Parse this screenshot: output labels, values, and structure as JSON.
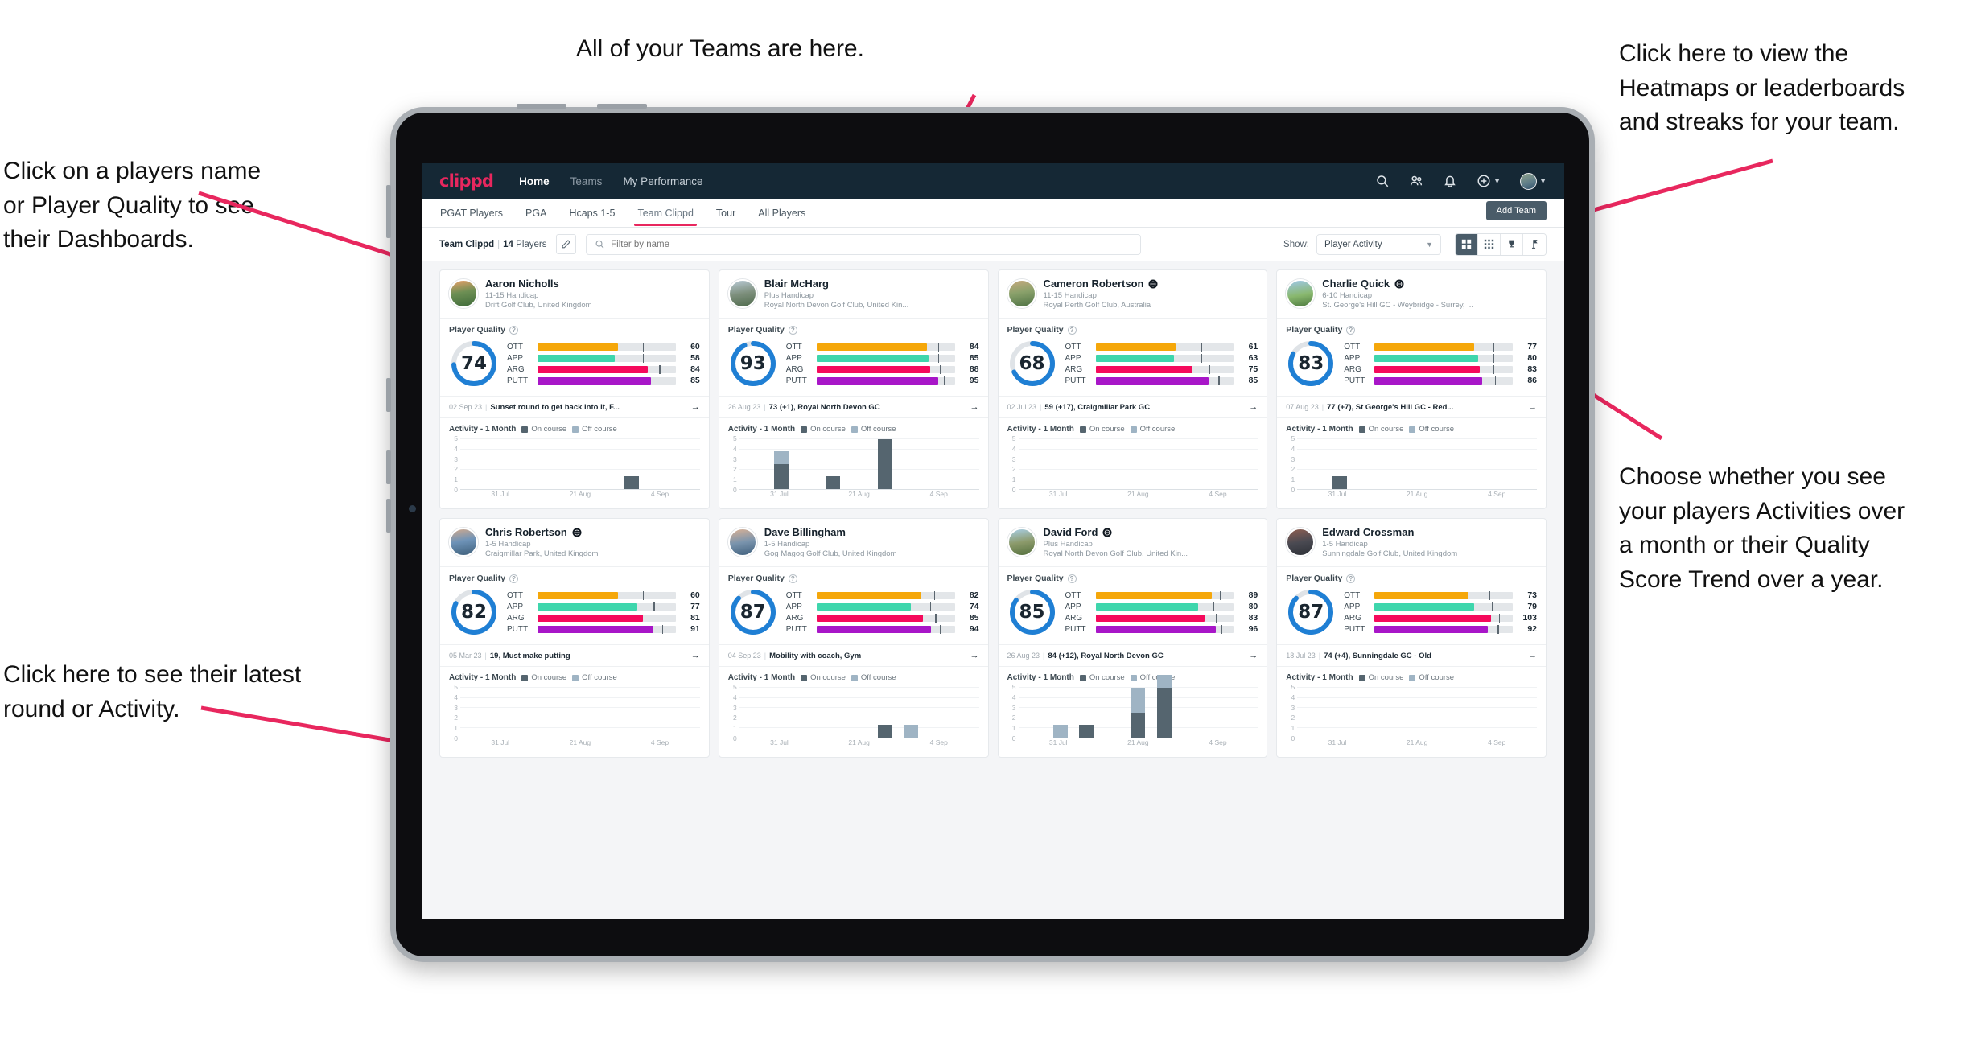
{
  "annotations": [
    {
      "id": "teams",
      "text": "All of your Teams are here."
    },
    {
      "id": "heatmaps",
      "text": "Click here to view the\nHeatmaps or leaderboards\nand streaks for your team."
    },
    {
      "id": "names",
      "text": "Click on a players name\nor Player Quality to see\ntheir Dashboards."
    },
    {
      "id": "activity",
      "text": "Choose whether you see\nyour players Activities over\na month or their Quality\nScore Trend over a year."
    },
    {
      "id": "latest",
      "text": "Click here to see their latest\nround or Activity."
    }
  ],
  "app": {
    "logo": "clippd",
    "nav": [
      {
        "label": "Home",
        "active": true
      },
      {
        "label": "Teams",
        "active": false
      },
      {
        "label": "My Performance",
        "active": false
      }
    ],
    "header_icons": [
      "search-icon",
      "people-icon",
      "bell-icon",
      "plus-circle-icon",
      "avatar"
    ],
    "tabs": [
      {
        "label": "PGAT Players",
        "active": false
      },
      {
        "label": "PGA",
        "active": false
      },
      {
        "label": "Hcaps 1-5",
        "active": false
      },
      {
        "label": "Team Clippd",
        "active": true
      },
      {
        "label": "Tour",
        "active": false
      },
      {
        "label": "All Players",
        "active": false
      }
    ],
    "add_team_label": "Add Team",
    "toolbar": {
      "team_name": "Team Clippd",
      "team_count": "14",
      "team_count_suffix": "Players",
      "separator": "|",
      "edit_icon": "pencil-icon",
      "search_placeholder": "Filter by name",
      "show_label": "Show:",
      "show_value": "Player Activity",
      "show_options": [
        "Player Activity",
        "Quality Score Trend"
      ],
      "view_buttons": [
        "grid-large-icon",
        "grid-small-icon",
        "trophy-icon",
        "flag-icon"
      ],
      "view_selected": 0
    }
  },
  "colors": {
    "brand_pink": "#e8275e",
    "appbar": "#152835",
    "ott": "#f5a70a",
    "app": "#3ed6ac",
    "arg": "#f50a5c",
    "putt": "#a816c8",
    "gauge": "#1f7fd4",
    "on_course": "#55656f",
    "off_course": "#9fb4c4"
  },
  "card_labels": {
    "player_quality": "Player Quality",
    "activity": "Activity - 1 Month",
    "legend_on": "On course",
    "legend_off": "Off course",
    "metric_names": [
      "OTT",
      "APP",
      "ARG",
      "PUTT"
    ]
  },
  "chart_data": {
    "type": "bar",
    "title": "Activity - 1 Month",
    "ylabel": "",
    "xlabel": "",
    "ylim": [
      0,
      5
    ],
    "yticks": [
      0,
      1,
      2,
      3,
      4,
      5
    ],
    "xticks": [
      "31 Jul",
      "21 Aug",
      "4 Sep"
    ],
    "stacked": true,
    "legend": [
      "On course",
      "Off course"
    ],
    "legend_position": "top",
    "grid": true,
    "panels": [
      {
        "player": "Aaron Nicholls",
        "on_course": [
          0,
          0,
          0,
          0,
          0,
          0,
          1,
          0,
          0
        ],
        "off_course": [
          0,
          0,
          0,
          0,
          0,
          0,
          0,
          0,
          0
        ]
      },
      {
        "player": "Blair McHarg",
        "on_course": [
          0,
          2,
          0,
          1,
          0,
          4,
          0,
          0,
          0
        ],
        "off_course": [
          0,
          1,
          0,
          0,
          0,
          0,
          0,
          0,
          0
        ]
      },
      {
        "player": "Cameron Robertson",
        "on_course": [
          0,
          0,
          0,
          0,
          0,
          0,
          0,
          0,
          0
        ],
        "off_course": [
          0,
          0,
          0,
          0,
          0,
          0,
          0,
          0,
          0
        ]
      },
      {
        "player": "Charlie Quick",
        "on_course": [
          0,
          1,
          0,
          0,
          0,
          0,
          0,
          0,
          0
        ],
        "off_course": [
          0,
          0,
          0,
          0,
          0,
          0,
          0,
          0,
          0
        ]
      },
      {
        "player": "Chris Robertson",
        "on_course": [
          0,
          0,
          0,
          0,
          0,
          0,
          0,
          0,
          0
        ],
        "off_course": [
          0,
          0,
          0,
          0,
          0,
          0,
          0,
          0,
          0
        ]
      },
      {
        "player": "Dave Billingham",
        "on_course": [
          0,
          0,
          0,
          0,
          0,
          1,
          0,
          0,
          0
        ],
        "off_course": [
          0,
          0,
          0,
          0,
          0,
          0,
          1,
          0,
          0
        ]
      },
      {
        "player": "David Ford",
        "on_course": [
          0,
          0,
          1,
          0,
          2,
          4,
          0,
          0,
          0
        ],
        "off_course": [
          0,
          1,
          0,
          0,
          2,
          1,
          0,
          0,
          0
        ]
      },
      {
        "player": "Edward Crossman",
        "on_course": [
          0,
          0,
          0,
          0,
          0,
          0,
          0,
          0,
          0
        ],
        "off_course": [
          0,
          0,
          0,
          0,
          0,
          0,
          0,
          0,
          0
        ]
      }
    ]
  },
  "players": [
    {
      "name": "Aaron Nicholls",
      "badge": false,
      "handicap": "11-15 Handicap",
      "club": "Drift Golf Club, United Kingdom",
      "quality": 74,
      "metrics": [
        {
          "label": "OTT",
          "value": 60,
          "fill": 58,
          "tick": 76
        },
        {
          "label": "APP",
          "value": 58,
          "fill": 56,
          "tick": 76
        },
        {
          "label": "ARG",
          "value": 84,
          "fill": 80,
          "tick": 88
        },
        {
          "label": "PUTT",
          "value": 85,
          "fill": 82,
          "tick": 89
        }
      ],
      "round_date": "02 Sep 23",
      "round_text": "Sunset round to get back into it, F..."
    },
    {
      "name": "Blair McHarg",
      "badge": false,
      "handicap": "Plus Handicap",
      "club": "Royal North Devon Golf Club, United Kin...",
      "quality": 93,
      "metrics": [
        {
          "label": "OTT",
          "value": 84,
          "fill": 80,
          "tick": 88
        },
        {
          "label": "APP",
          "value": 85,
          "fill": 81,
          "tick": 88
        },
        {
          "label": "ARG",
          "value": 88,
          "fill": 82,
          "tick": 89
        },
        {
          "label": "PUTT",
          "value": 95,
          "fill": 88,
          "tick": 92
        }
      ],
      "round_date": "26 Aug 23",
      "round_text": "73 (+1), Royal North Devon GC"
    },
    {
      "name": "Cameron Robertson",
      "badge": true,
      "handicap": "11-15 Handicap",
      "club": "Royal Perth Golf Club, Australia",
      "quality": 68,
      "metrics": [
        {
          "label": "OTT",
          "value": 61,
          "fill": 58,
          "tick": 76
        },
        {
          "label": "APP",
          "value": 63,
          "fill": 57,
          "tick": 76
        },
        {
          "label": "ARG",
          "value": 75,
          "fill": 70,
          "tick": 82
        },
        {
          "label": "PUTT",
          "value": 85,
          "fill": 82,
          "tick": 89
        }
      ],
      "round_date": "02 Jul 23",
      "round_text": "59 (+17), Craigmillar Park GC"
    },
    {
      "name": "Charlie Quick",
      "badge": true,
      "handicap": "6-10 Handicap",
      "club": "St. George's Hill GC - Weybridge - Surrey, ...",
      "quality": 83,
      "metrics": [
        {
          "label": "OTT",
          "value": 77,
          "fill": 72,
          "tick": 86
        },
        {
          "label": "APP",
          "value": 80,
          "fill": 75,
          "tick": 86
        },
        {
          "label": "ARG",
          "value": 83,
          "fill": 76,
          "tick": 86
        },
        {
          "label": "PUTT",
          "value": 86,
          "fill": 78,
          "tick": 87
        }
      ],
      "round_date": "07 Aug 23",
      "round_text": "77 (+7), St George's Hill GC - Red..."
    },
    {
      "name": "Chris Robertson",
      "badge": true,
      "handicap": "1-5 Handicap",
      "club": "Craigmillar Park, United Kingdom",
      "quality": 82,
      "metrics": [
        {
          "label": "OTT",
          "value": 60,
          "fill": 58,
          "tick": 76
        },
        {
          "label": "APP",
          "value": 77,
          "fill": 72,
          "tick": 84
        },
        {
          "label": "ARG",
          "value": 81,
          "fill": 76,
          "tick": 86
        },
        {
          "label": "PUTT",
          "value": 91,
          "fill": 84,
          "tick": 90
        }
      ],
      "round_date": "05 Mar 23",
      "round_text": "19, Must make putting"
    },
    {
      "name": "Dave Billingham",
      "badge": false,
      "handicap": "1-5 Handicap",
      "club": "Gog Magog Golf Club, United Kingdom",
      "quality": 87,
      "metrics": [
        {
          "label": "OTT",
          "value": 82,
          "fill": 76,
          "tick": 85
        },
        {
          "label": "APP",
          "value": 74,
          "fill": 68,
          "tick": 82
        },
        {
          "label": "ARG",
          "value": 85,
          "fill": 77,
          "tick": 86
        },
        {
          "label": "PUTT",
          "value": 94,
          "fill": 83,
          "tick": 89
        }
      ],
      "round_date": "04 Sep 23",
      "round_text": "Mobility with coach, Gym"
    },
    {
      "name": "David Ford",
      "badge": true,
      "handicap": "Plus Handicap",
      "club": "Royal North Devon Golf Club, United Kin...",
      "quality": 85,
      "metrics": [
        {
          "label": "OTT",
          "value": 89,
          "fill": 84,
          "tick": 90
        },
        {
          "label": "APP",
          "value": 80,
          "fill": 74,
          "tick": 85
        },
        {
          "label": "ARG",
          "value": 83,
          "fill": 79,
          "tick": 87
        },
        {
          "label": "PUTT",
          "value": 96,
          "fill": 87,
          "tick": 91
        }
      ],
      "round_date": "26 Aug 23",
      "round_text": "84 (+12), Royal North Devon GC"
    },
    {
      "name": "Edward Crossman",
      "badge": false,
      "handicap": "1-5 Handicap",
      "club": "Sunningdale Golf Club, United Kingdom",
      "quality": 87,
      "metrics": [
        {
          "label": "OTT",
          "value": 73,
          "fill": 68,
          "tick": 83
        },
        {
          "label": "APP",
          "value": 79,
          "fill": 72,
          "tick": 85
        },
        {
          "label": "ARG",
          "value": 103,
          "fill": 84,
          "tick": 90
        },
        {
          "label": "PUTT",
          "value": 92,
          "fill": 82,
          "tick": 89
        }
      ],
      "round_date": "18 Jul 23",
      "round_text": "74 (+4), Sunningdale GC - Old"
    }
  ]
}
